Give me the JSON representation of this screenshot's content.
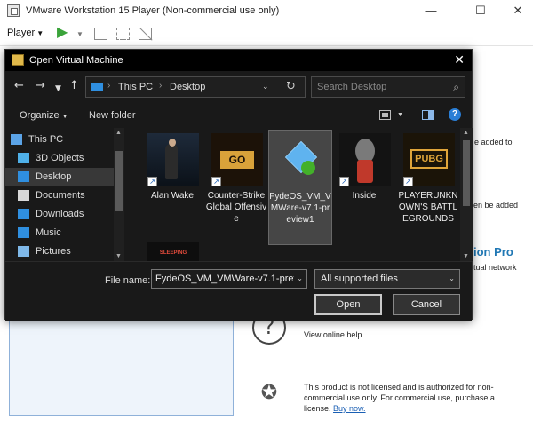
{
  "window": {
    "title": "VMware Workstation 15 Player (Non-commercial use only)",
    "minimize_glyph": "—",
    "maximize_glyph": "☐",
    "close_glyph": "✕"
  },
  "toolbar": {
    "player_label": "Player",
    "player_caret": "▼",
    "play_glyph": "▶",
    "play_caret": "▼"
  },
  "home": {
    "right_heading_fragment": "e",
    "line1_fragment": "e added to",
    "line2_fragment": "l",
    "line3_fragment": "en be added",
    "pro_heading_fragment": "ion Pro",
    "pro_line_fragment": "tual network",
    "help_glyph": "?",
    "help_text": "View online help.",
    "license_glyph": "✪",
    "license_text": "This product is not licensed and is authorized for non-commercial use only. For commercial use, purchase a license.",
    "license_link": "Buy now."
  },
  "dialog": {
    "title": "Open Virtual Machine",
    "close_glyph": "✕",
    "nav": {
      "back_glyph": "←",
      "forward_glyph": "→",
      "recent_glyph": "▼",
      "up_glyph": "↑",
      "path": [
        "This PC",
        "Desktop"
      ],
      "path_separator": "›",
      "refresh_glyph": "↻",
      "dropdown_glyph": "⌄",
      "search_placeholder": "Search Desktop",
      "search_glyph": "⌕"
    },
    "commands": {
      "organize": "Organize",
      "new_folder": "New folder",
      "caret": "▼",
      "info_glyph": "?"
    },
    "sidebar": [
      {
        "label": "This PC",
        "icon": "this-pc-icon",
        "color": "#5ba3e6",
        "indent": 24,
        "selected": false
      },
      {
        "label": "3D Objects",
        "icon": "3d-objects-icon",
        "color": "#4fb0e8",
        "indent": 32,
        "selected": false
      },
      {
        "label": "Desktop",
        "icon": "desktop-icon",
        "color": "#2f8fe0",
        "indent": 32,
        "selected": true
      },
      {
        "label": "Documents",
        "icon": "documents-icon",
        "color": "#d8d8d8",
        "indent": 32,
        "selected": false
      },
      {
        "label": "Downloads",
        "icon": "downloads-icon",
        "color": "#2f8fe0",
        "indent": 32,
        "selected": false
      },
      {
        "label": "Music",
        "icon": "music-icon",
        "color": "#2f8fe0",
        "indent": 32,
        "selected": false
      },
      {
        "label": "Pictures",
        "icon": "pictures-icon",
        "color": "#7fb8e8",
        "indent": 32,
        "selected": false
      }
    ],
    "files": [
      {
        "label": "Alan Wake",
        "icon": "alan-wake-icon",
        "shortcut": true,
        "selected": false
      },
      {
        "label": "Counter-Strike Global Offensive",
        "icon": "csgo-icon",
        "shortcut": true,
        "selected": false
      },
      {
        "label": "FydeOS_VM_VMWare-v7.1-preview1",
        "icon": "vmware-file-icon",
        "shortcut": false,
        "selected": true
      },
      {
        "label": "Inside",
        "icon": "inside-icon",
        "shortcut": true,
        "selected": false
      },
      {
        "label": "PLAYERUNKNOWN'S BATTLEGROUNDS",
        "icon": "pubg-icon",
        "shortcut": true,
        "selected": false
      },
      {
        "label": "",
        "icon": "sleeping-dogs-icon",
        "shortcut": false,
        "selected": false
      }
    ],
    "tile_art": {
      "csgo": "GO",
      "pubg": "PUBG",
      "sleeping": "SLEEPING",
      "shortcut": "↗"
    },
    "scroll_up": "▲",
    "scroll_down": "▼",
    "file_name_label": "File name:",
    "file_name_value": "FydeOS_VM_VMWare-v7.1-preview1",
    "file_type_value": "All supported files",
    "select_caret": "⌄",
    "open_button": "Open",
    "cancel_button": "Cancel"
  }
}
